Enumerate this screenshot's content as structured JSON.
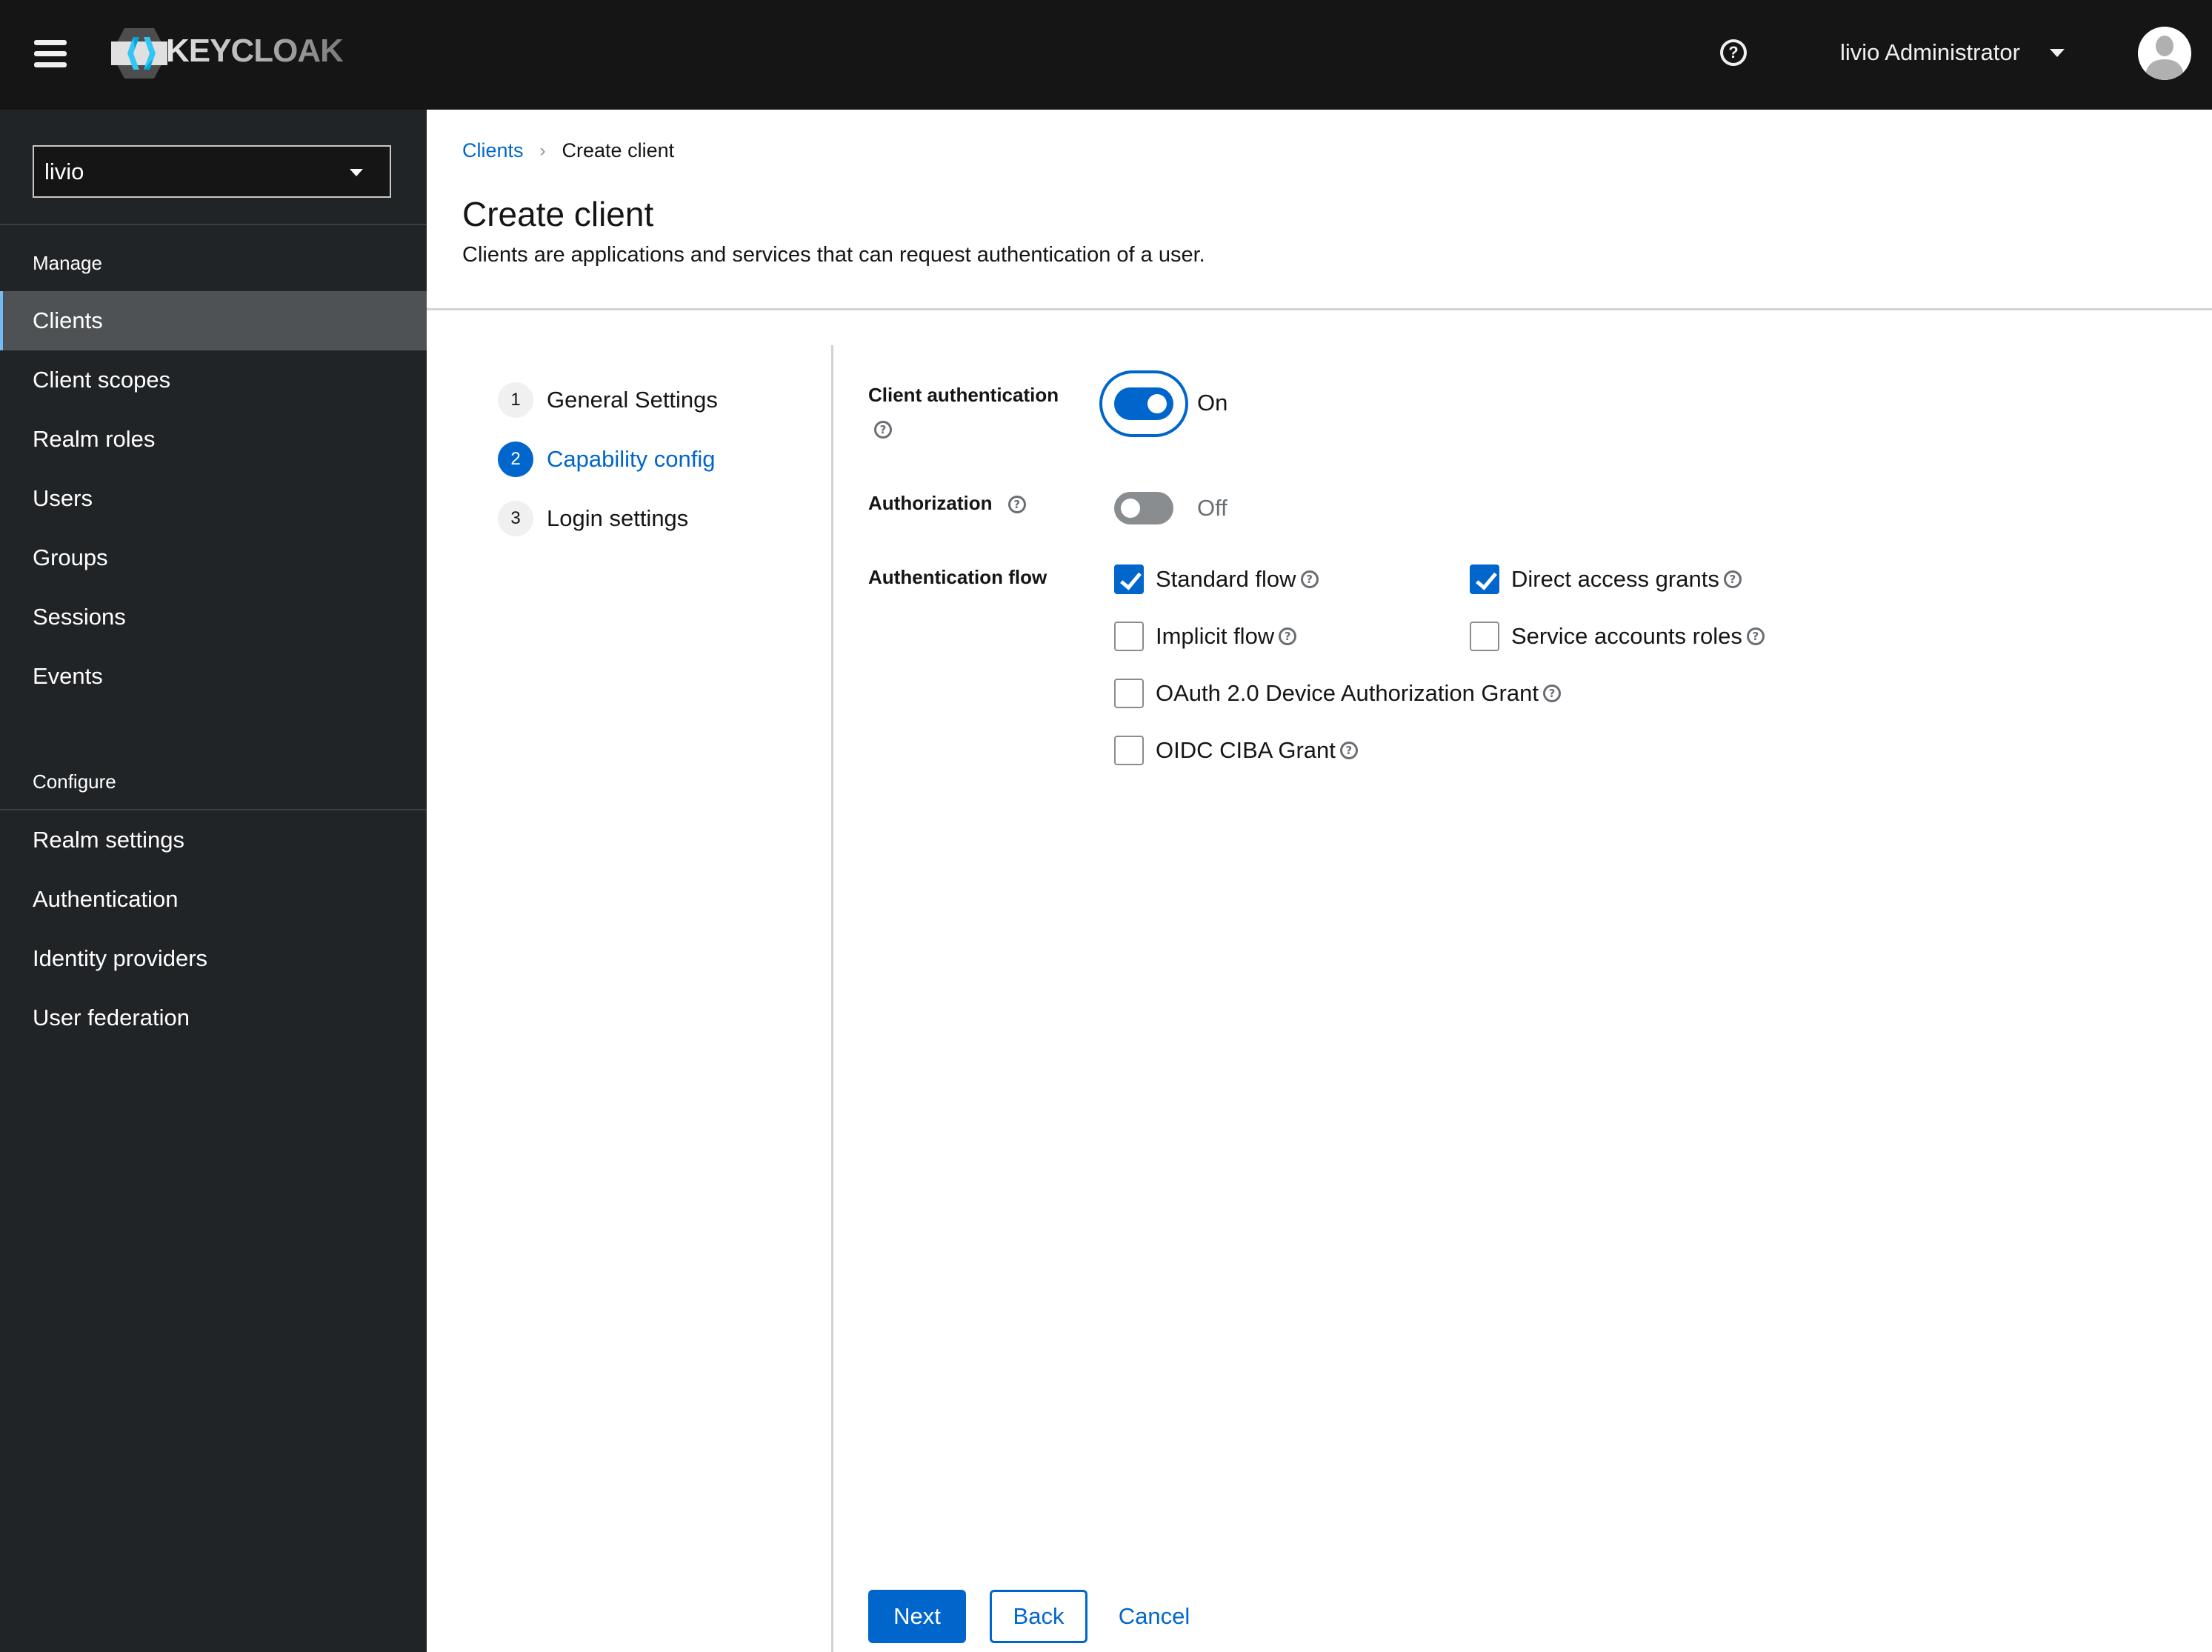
{
  "masthead": {
    "brand": "KEYCLOAK",
    "menu_icon": "hamburger-icon",
    "help_icon": "question-circle-icon",
    "help_glyph": "?",
    "user_name": "livio Administrator",
    "user_caret_icon": "caret-down-icon",
    "avatar_icon": "user-avatar-icon"
  },
  "sidebar": {
    "realm": "livio",
    "sections": [
      {
        "label": "Manage",
        "items": [
          {
            "label": "Clients",
            "active": true
          },
          {
            "label": "Client scopes",
            "active": false
          },
          {
            "label": "Realm roles",
            "active": false
          },
          {
            "label": "Users",
            "active": false
          },
          {
            "label": "Groups",
            "active": false
          },
          {
            "label": "Sessions",
            "active": false
          },
          {
            "label": "Events",
            "active": false
          }
        ]
      },
      {
        "label": "Configure",
        "items": [
          {
            "label": "Realm settings",
            "active": false
          },
          {
            "label": "Authentication",
            "active": false
          },
          {
            "label": "Identity providers",
            "active": false
          },
          {
            "label": "User federation",
            "active": false
          }
        ]
      }
    ]
  },
  "breadcrumb": {
    "items": [
      {
        "label": "Clients",
        "link": true
      },
      {
        "label": "Create client",
        "link": false
      }
    ],
    "separator": "›"
  },
  "page": {
    "title": "Create client",
    "description": "Clients are applications and services that can request authentication of a user."
  },
  "wizard": {
    "steps": [
      {
        "number": "1",
        "label": "General Settings",
        "current": false
      },
      {
        "number": "2",
        "label": "Capability config",
        "current": true
      },
      {
        "number": "3",
        "label": "Login settings",
        "current": false
      }
    ]
  },
  "form": {
    "client_authentication": {
      "label": "Client authentication",
      "value": true,
      "state_text": "On"
    },
    "authorization": {
      "label": "Authorization",
      "value": false,
      "state_text": "Off"
    },
    "authentication_flow": {
      "label": "Authentication flow",
      "options": [
        {
          "label": "Standard flow",
          "checked": true
        },
        {
          "label": "Direct access grants",
          "checked": true
        },
        {
          "label": "Implicit flow",
          "checked": false
        },
        {
          "label": "Service accounts roles",
          "checked": false
        },
        {
          "label": "OAuth 2.0 Device Authorization Grant",
          "checked": false
        },
        {
          "label": "OIDC CIBA Grant",
          "checked": false
        }
      ]
    }
  },
  "footer": {
    "next_label": "Next",
    "back_label": "Back",
    "cancel_label": "Cancel"
  },
  "colors": {
    "accent": "#0066cc",
    "masthead_bg": "#151515",
    "sidebar_bg": "#212427",
    "sidebar_active_bg": "#4f5255",
    "sidebar_active_indicator": "#73bcf7"
  }
}
